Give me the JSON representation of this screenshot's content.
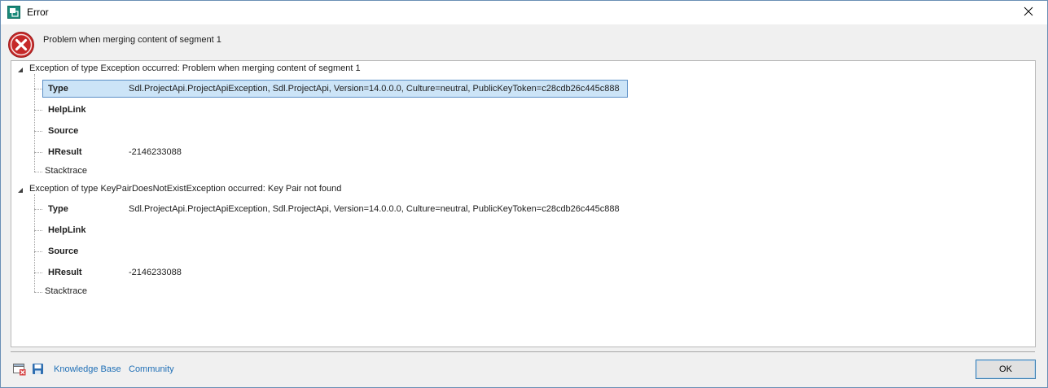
{
  "window": {
    "title": "Error",
    "header_message": "Problem when merging content of segment 1"
  },
  "exceptions": [
    {
      "label": "Exception of type Exception occurred: Problem when merging content of segment 1",
      "expanded": true,
      "properties": [
        {
          "name": "Type",
          "value": "Sdl.ProjectApi.ProjectApiException, Sdl.ProjectApi, Version=14.0.0.0, Culture=neutral, PublicKeyToken=c28cdb26c445c888",
          "selected": true
        },
        {
          "name": "HelpLink",
          "value": ""
        },
        {
          "name": "Source",
          "value": ""
        },
        {
          "name": "HResult",
          "value": "-2146233088"
        }
      ],
      "stacktrace_label": "Stacktrace"
    },
    {
      "label": "Exception of type KeyPairDoesNotExistException occurred: Key Pair not found",
      "expanded": true,
      "properties": [
        {
          "name": "Type",
          "value": "Sdl.ProjectApi.ProjectApiException, Sdl.ProjectApi, Version=14.0.0.0, Culture=neutral, PublicKeyToken=c28cdb26c445c888",
          "selected": false
        },
        {
          "name": "HelpLink",
          "value": ""
        },
        {
          "name": "Source",
          "value": ""
        },
        {
          "name": "HResult",
          "value": "-2146233088"
        }
      ],
      "stacktrace_label": "Stacktrace"
    }
  ],
  "footer": {
    "icons": [
      "error-report-icon",
      "save-icon"
    ],
    "links": [
      "Knowledge Base",
      "Community"
    ],
    "ok_label": "OK"
  },
  "colors": {
    "link": "#1f6fb6",
    "selection": "#cce4f7",
    "selection_border": "#5b8fc7",
    "error_red": "#c62828"
  }
}
